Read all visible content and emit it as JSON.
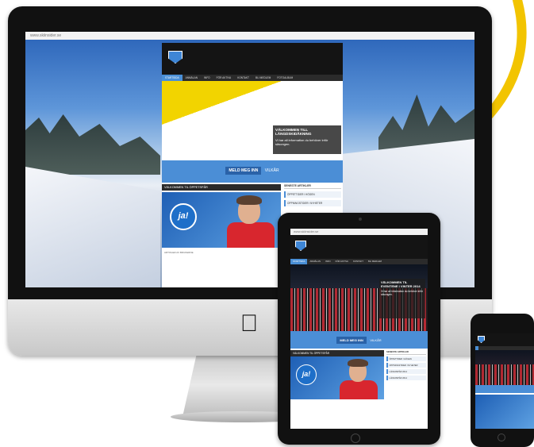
{
  "accent_blue": "#4b8ed6",
  "accent_yellow": "#f2c400",
  "imac": {
    "url": "www.skiinsider.se",
    "nav": [
      "STARTSIDA",
      "ANMÄLAN",
      "INFO",
      "FÖR AKTIVA",
      "KONTAKT",
      "BLI MEDLEM",
      "FOTOALBUM",
      "KONTAKTA OSS"
    ],
    "hero_title": "VÄLKOMMEN TILL LÄNGDSKIDÅKNING",
    "hero_text": "Vi har all information du behöver inför säsongen.",
    "cta_button": "MELD MEG INN",
    "cta_link": "VILKÅR",
    "story_title": "VÄLKOMMEN TIL ÖPPETSPÅR",
    "badge": "ja!",
    "side_title": "SENESTE ARTIKLER",
    "side_items": [
      "ÖPPETTIDER I HÖGEN",
      "OPPNINGSTIDER I NYHETER"
    ],
    "story_footer": "ARTIKLER AV BRUKERNE"
  },
  "ipad": {
    "url": "www.skiinsider.se",
    "nav": [
      "STARTSIDA",
      "ANMÄLAN",
      "INFO",
      "FÖR AKTIVA",
      "KONTAKT",
      "BLI MEDLEM",
      "KONTAKTA OSS"
    ],
    "hero_title": "VÄLKOMMEN TIL EVENTENE I VINTER 2014",
    "hero_text": "Vi har all information du behöver inför säsongen.",
    "cta_button": "MELD MEG INN",
    "cta_link": "VILKÅR",
    "story_title": "VÄLKOMMEN TIL ÖPPETSPÅR",
    "badge": "ja!",
    "side_title": "SENESTE ARTIKLER",
    "side_items": [
      "ÖPPETTIDER I HÖGEN",
      "OPPNINGSTIDER I NYHETER",
      "LÄNGDSPÅR 2014",
      "LÄNGDSPÅR 2014"
    ]
  }
}
